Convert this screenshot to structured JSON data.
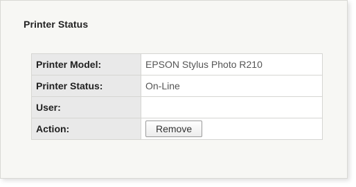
{
  "section": {
    "title": "Printer Status"
  },
  "rows": [
    {
      "label": "Printer Model:",
      "value": "EPSON Stylus Photo R210"
    },
    {
      "label": "Printer Status:",
      "value": "On-Line"
    },
    {
      "label": "User:",
      "value": ""
    },
    {
      "label": "Action:",
      "button_label": "Remove"
    }
  ]
}
